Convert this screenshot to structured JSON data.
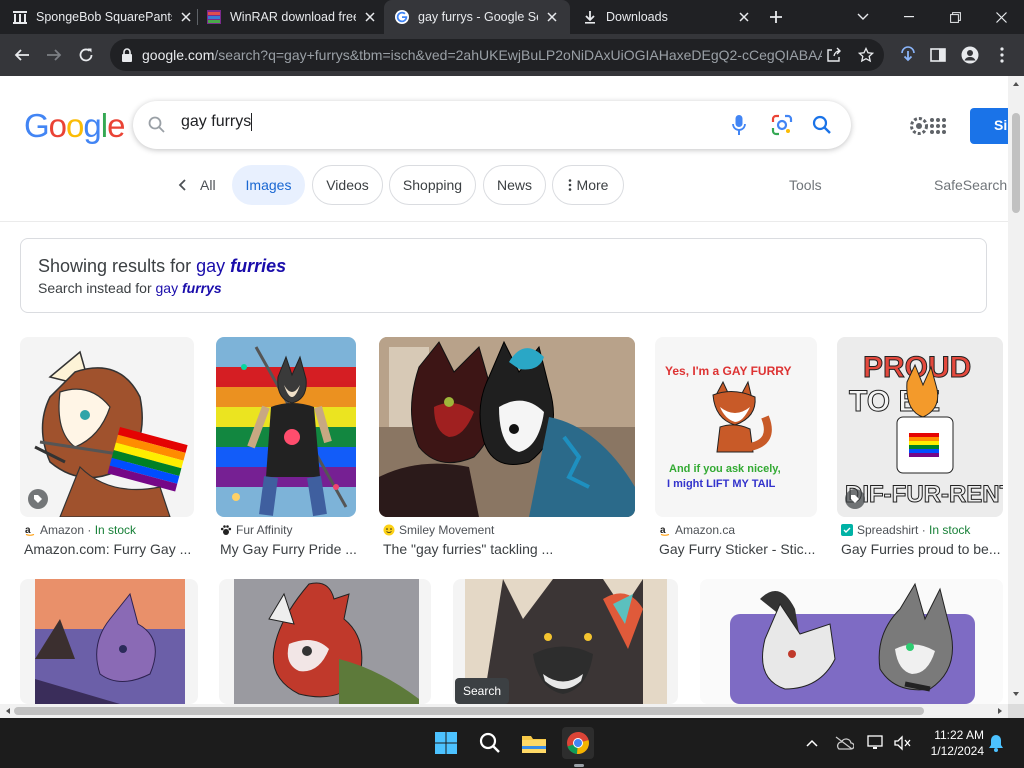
{
  "tabs": [
    {
      "title": "SpongeBob SquarePants",
      "favicon": "columns-icon"
    },
    {
      "title": "WinRAR download free",
      "favicon": "winrar-icon"
    },
    {
      "title": "gay furrys - Google Search",
      "favicon": "google-icon",
      "active": true
    },
    {
      "title": "Downloads",
      "favicon": "download-icon"
    }
  ],
  "address_bar": {
    "host": "google.com",
    "path": "/search?q=gay+furrys&tbm=isch&ved=2ahUKEwjBuLP2oNiDAxUiOGIAHaxeDEgQ2-cCegQIABAA"
  },
  "google": {
    "logo_letters": [
      "G",
      "o",
      "o",
      "g",
      "l",
      "e"
    ],
    "logo_colors": [
      "#4285f4",
      "#ea4335",
      "#fbbc05",
      "#4285f4",
      "#34a853",
      "#ea4335"
    ],
    "query": "gay furrys",
    "signin_label": "Si"
  },
  "filters": {
    "all_label": "All",
    "chips": [
      "Images",
      "Videos",
      "Shopping",
      "News",
      "More"
    ],
    "selected": "Images",
    "tools_label": "Tools",
    "safesearch_label": "SafeSearch"
  },
  "spelling": {
    "showing_prefix": "Showing results for",
    "corrected_plain": "gay",
    "corrected_bold": "furries",
    "instead_prefix": "Search instead for",
    "original_plain": "gay",
    "original_bold": "furrys"
  },
  "results": [
    {
      "source": "Amazon",
      "stock": "In stock",
      "title": "Amazon.com: Furry Gay ...",
      "favicon": "amazon-icon"
    },
    {
      "source": "Fur Affinity",
      "stock": "",
      "title": "My Gay Furry Pride ...",
      "favicon": "paw-icon"
    },
    {
      "source": "Smiley Movement",
      "stock": "",
      "title": "The \"gay furries\" tackling ...",
      "favicon": "smiley-icon"
    },
    {
      "source": "Amazon.ca",
      "stock": "",
      "title": "Gay Furry Sticker - Stic...",
      "favicon": "amazon-icon"
    },
    {
      "source": "Spreadshirt",
      "stock": "In stock",
      "title": "Gay Furries proud to be...",
      "favicon": "spreadshirt-icon"
    }
  ],
  "sticker_text": {
    "line1": "Yes, I'm a GAY FURRY",
    "line2": "And if you ask nicely,",
    "line3": "I might LIFT MY TAIL"
  },
  "shirt_text": {
    "top1": "PROUD",
    "top2": "TO BE",
    "bottom": "DIF-FUR-RENT"
  },
  "tooltip": "Search",
  "clock": {
    "time": "11:22 AM",
    "date": "1/12/2024"
  },
  "colors": {
    "accent": "#1a73e8",
    "link": "#1a0dab",
    "chip_selected_bg": "#e8f0fe",
    "in_stock": "#188038"
  }
}
